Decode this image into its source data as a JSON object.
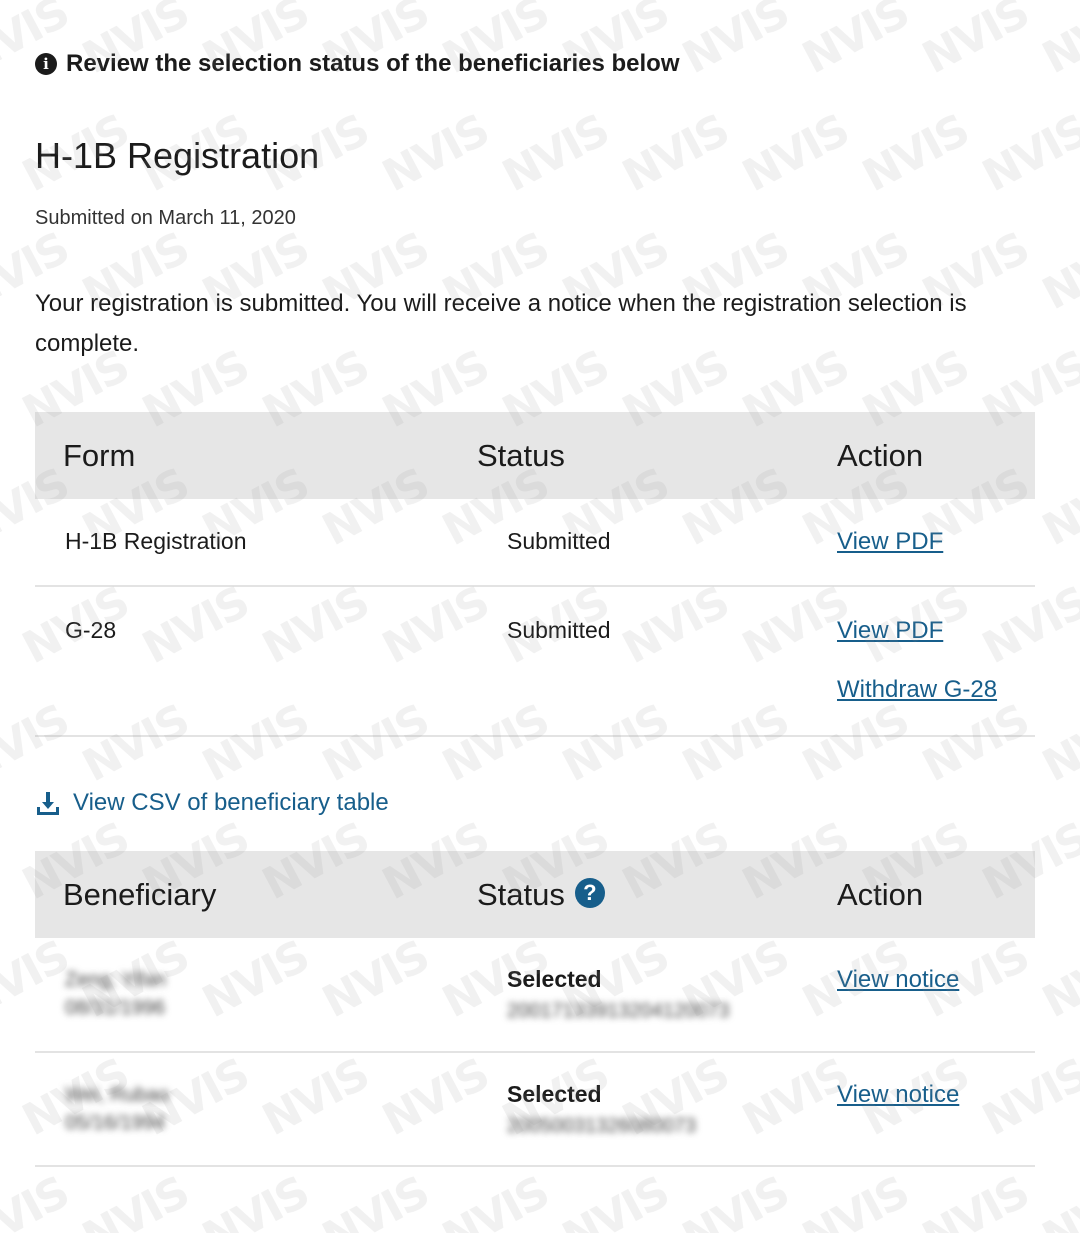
{
  "alert": {
    "icon": "info-circle-icon",
    "text": "Review the selection status of the beneficiaries below"
  },
  "page": {
    "title": "H-1B Registration",
    "submitted_on": "Submitted on March 11, 2020",
    "description": "Your registration is submitted. You will receive a notice when the registration selection is complete."
  },
  "forms_table": {
    "headers": [
      "Form",
      "Status",
      "Action"
    ],
    "rows": [
      {
        "form": "H-1B Registration",
        "status": "Submitted",
        "actions": [
          "View PDF"
        ]
      },
      {
        "form": "G-28",
        "status": "Submitted",
        "actions": [
          "View PDF",
          "Withdraw G-28"
        ]
      }
    ]
  },
  "csv_link": {
    "icon": "download-icon",
    "label": "View CSV of beneficiary table"
  },
  "beneficiary_table": {
    "headers": [
      "Beneficiary",
      "Status",
      "Action"
    ],
    "status_help_icon": "question-circle-icon",
    "rows": [
      {
        "name": "Zeng, Yifan",
        "dob": "08/31/1996",
        "status": "Selected",
        "confirmation": "20017133913204120073",
        "action": "View notice"
      },
      {
        "name": "Wei, Rubao",
        "dob": "05/16/1994",
        "status": "Selected",
        "confirmation": "20050031326080073",
        "action": "View notice"
      }
    ]
  },
  "watermark": {
    "text": "NVIS",
    "color": "#969696"
  },
  "colors": {
    "link": "#175e8b",
    "header_bg": "#e6e6e6",
    "text": "#1b1b1b"
  }
}
